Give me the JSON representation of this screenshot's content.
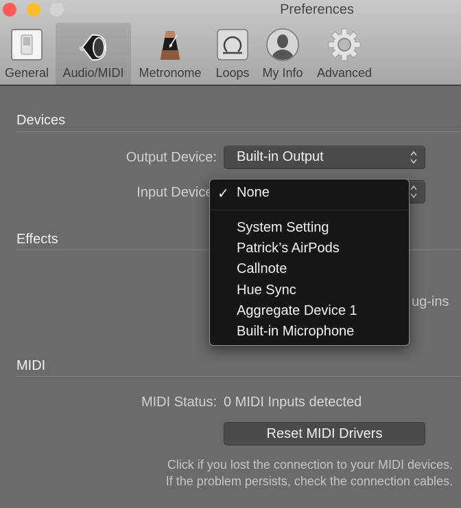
{
  "window": {
    "title": "Preferences",
    "controls": [
      "close",
      "minimize",
      "zoom"
    ]
  },
  "toolbar": {
    "tabs": [
      {
        "label": "General",
        "icon": "switch-icon",
        "active": false
      },
      {
        "label": "Audio/MIDI",
        "icon": "speaker-icon",
        "active": true
      },
      {
        "label": "Metronome",
        "icon": "metronome-icon",
        "active": false
      },
      {
        "label": "Loops",
        "icon": "loop-icon",
        "active": false
      },
      {
        "label": "My Info",
        "icon": "user-icon",
        "active": false
      },
      {
        "label": "Advanced",
        "icon": "gear-icon",
        "active": false
      }
    ]
  },
  "devices": {
    "section_title": "Devices",
    "output_label": "Output Device:",
    "output_value": "Built-in Output",
    "input_label": "Input Device:",
    "input_value": "None"
  },
  "input_menu": {
    "selected": "None",
    "check_glyph": "✓",
    "items": [
      "None",
      "System Setting",
      "Patrick’s AirPods",
      "Callnote",
      "Hue Sync",
      "Aggregate Device 1",
      "Built-in Microphone"
    ]
  },
  "effects": {
    "section_title": "Effects",
    "partial_text": "ug-ins"
  },
  "midi": {
    "section_title": "MIDI",
    "status_label": "MIDI Status:",
    "status_value": "0 MIDI Inputs detected",
    "reset_button": "Reset MIDI Drivers",
    "help_line1": "Click if you lost the connection to your MIDI devices.",
    "help_line2": "If the problem persists, check the connection cables."
  },
  "colors": {
    "close": "#fc5d57",
    "minimize": "#fdbc2e",
    "zoom": "#d1d4d4",
    "background": "#6b6b6b",
    "menu_bg": "#161616"
  }
}
